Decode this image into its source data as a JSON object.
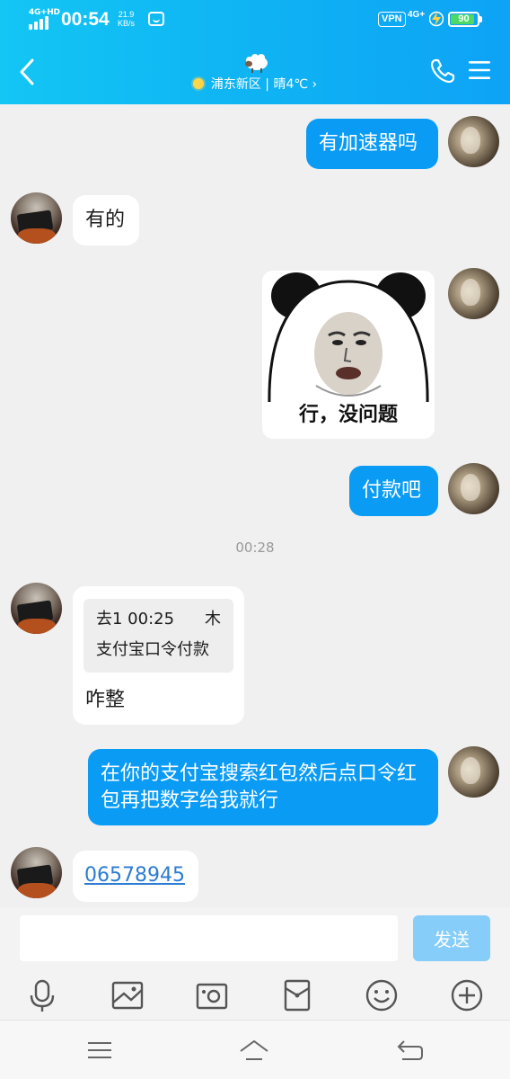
{
  "status_bar": {
    "network_tag": "4G+HD",
    "time": "00:54",
    "speed_value": "21.9",
    "speed_unit": "KB/s",
    "vpn": "VPN",
    "net_type": "4G+",
    "battery": "90"
  },
  "nav": {
    "location": "浦东新区 | 晴4℃ ›"
  },
  "messages": {
    "m1": "有加速器吗",
    "m2": "有的",
    "sticker_caption": "行，没问题",
    "m3": "付款吧",
    "timestamp": "00:28",
    "quote_head": "去1 00:25",
    "quote_pin": "⽊",
    "quote_text": "支付宝口令付款",
    "reply": "咋整",
    "m4": "在你的支付宝搜索红包然后点口令红包再把数字给我就行",
    "m5": "06578945"
  },
  "input": {
    "placeholder": "",
    "value": "",
    "send_label": "发送"
  },
  "toolbar_icons": [
    "microphone-icon",
    "image-icon",
    "camera-icon",
    "red-packet-icon",
    "emoji-icon",
    "plus-icon"
  ],
  "system_nav_icons": [
    "menu-icon",
    "home-icon",
    "back-icon"
  ],
  "colors": {
    "header_gradient_start": "#13c6f4",
    "header_gradient_end": "#0ea3f6",
    "outgoing_bubble": "#0a9bf5",
    "incoming_bubble": "#ffffff",
    "chat_background": "#f0f0f0",
    "send_button": "#86cdf9",
    "link": "#2b7cd3"
  }
}
